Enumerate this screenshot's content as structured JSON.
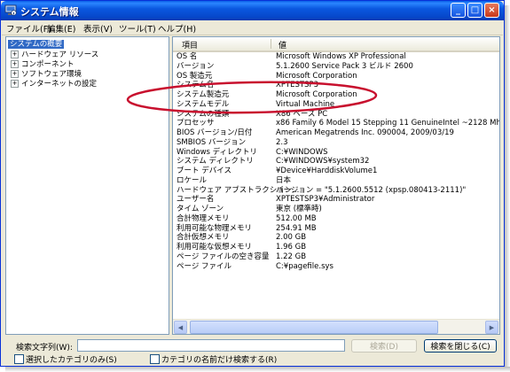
{
  "window": {
    "title": "システム情報",
    "controls": {
      "minimize": "_",
      "maximize": "□",
      "close": "×"
    }
  },
  "menubar": {
    "items": [
      {
        "label": "ファイル(F)"
      },
      {
        "label": "編集(E)"
      },
      {
        "label": "表示(V)"
      },
      {
        "label": "ツール(T)"
      },
      {
        "label": "ヘルプ(H)"
      }
    ]
  },
  "tree": {
    "root": "システムの概要",
    "children": [
      {
        "label": "ハードウェア リソース",
        "expander": "+"
      },
      {
        "label": "コンポーネント",
        "expander": "+"
      },
      {
        "label": "ソフトウェア環境",
        "expander": "+"
      },
      {
        "label": "インターネットの設定",
        "expander": "+"
      }
    ]
  },
  "list": {
    "headers": {
      "item": "項目",
      "value": "値"
    },
    "rows": [
      {
        "label": "OS 名",
        "value": "Microsoft Windows XP Professional"
      },
      {
        "label": "バージョン",
        "value": "5.1.2600 Service Pack 3 ビルド 2600"
      },
      {
        "label": "OS 製造元",
        "value": "Microsoft Corporation"
      },
      {
        "label": "システム名",
        "value": "XPTESTSP3"
      },
      {
        "label": "システム製造元",
        "value": "Microsoft Corporation"
      },
      {
        "label": "システムモデル",
        "value": "Virtual Machine"
      },
      {
        "label": "システムの種類",
        "value": "X86 ベース PC"
      },
      {
        "label": "プロセッサ",
        "value": "x86 Family 6 Model 15 Stepping 11 GenuineIntel ~2128 Mhz"
      },
      {
        "label": "BIOS バージョン/日付",
        "value": "American Megatrends Inc. 090004, 2009/03/19"
      },
      {
        "label": "SMBIOS バージョン",
        "value": "2.3"
      },
      {
        "label": "Windows ディレクトリ",
        "value": "C:¥WINDOWS"
      },
      {
        "label": "システム ディレクトリ",
        "value": "C:¥WINDOWS¥system32"
      },
      {
        "label": "ブート デバイス",
        "value": "¥Device¥HarddiskVolume1"
      },
      {
        "label": "ロケール",
        "value": "日本"
      },
      {
        "label": "ハードウェア アブストラクション...",
        "value": "バージョン = \"5.1.2600.5512 (xpsp.080413-2111)\""
      },
      {
        "label": "ユーザー名",
        "value": "XPTESTSP3¥Administrator"
      },
      {
        "label": "タイム ゾーン",
        "value": "東京 (標準時)"
      },
      {
        "label": "合計物理メモリ",
        "value": "512.00 MB"
      },
      {
        "label": "利用可能な物理メモリ",
        "value": "254.91 MB"
      },
      {
        "label": "合計仮想メモリ",
        "value": "2.00 GB"
      },
      {
        "label": "利用可能な仮想メモリ",
        "value": "1.96 GB"
      },
      {
        "label": "ページ ファイルの空き容量",
        "value": "1.22 GB"
      },
      {
        "label": "ページ ファイル",
        "value": "C:¥pagefile.sys"
      }
    ]
  },
  "scrollbar": {
    "left_arrow": "◀",
    "right_arrow": "▶"
  },
  "search": {
    "label": "検索文字列(W):",
    "value": "",
    "search_button": "検索(D)",
    "close_button": "検索を閉じる(C)",
    "option_selected_category": "選択したカテゴリのみ(S)",
    "option_category_names": "カテゴリの名前だけ検索する(R)"
  },
  "colors": {
    "annotation": "#c8102e",
    "selection": "#316ac5",
    "title_bar": "#0a5fe6"
  }
}
